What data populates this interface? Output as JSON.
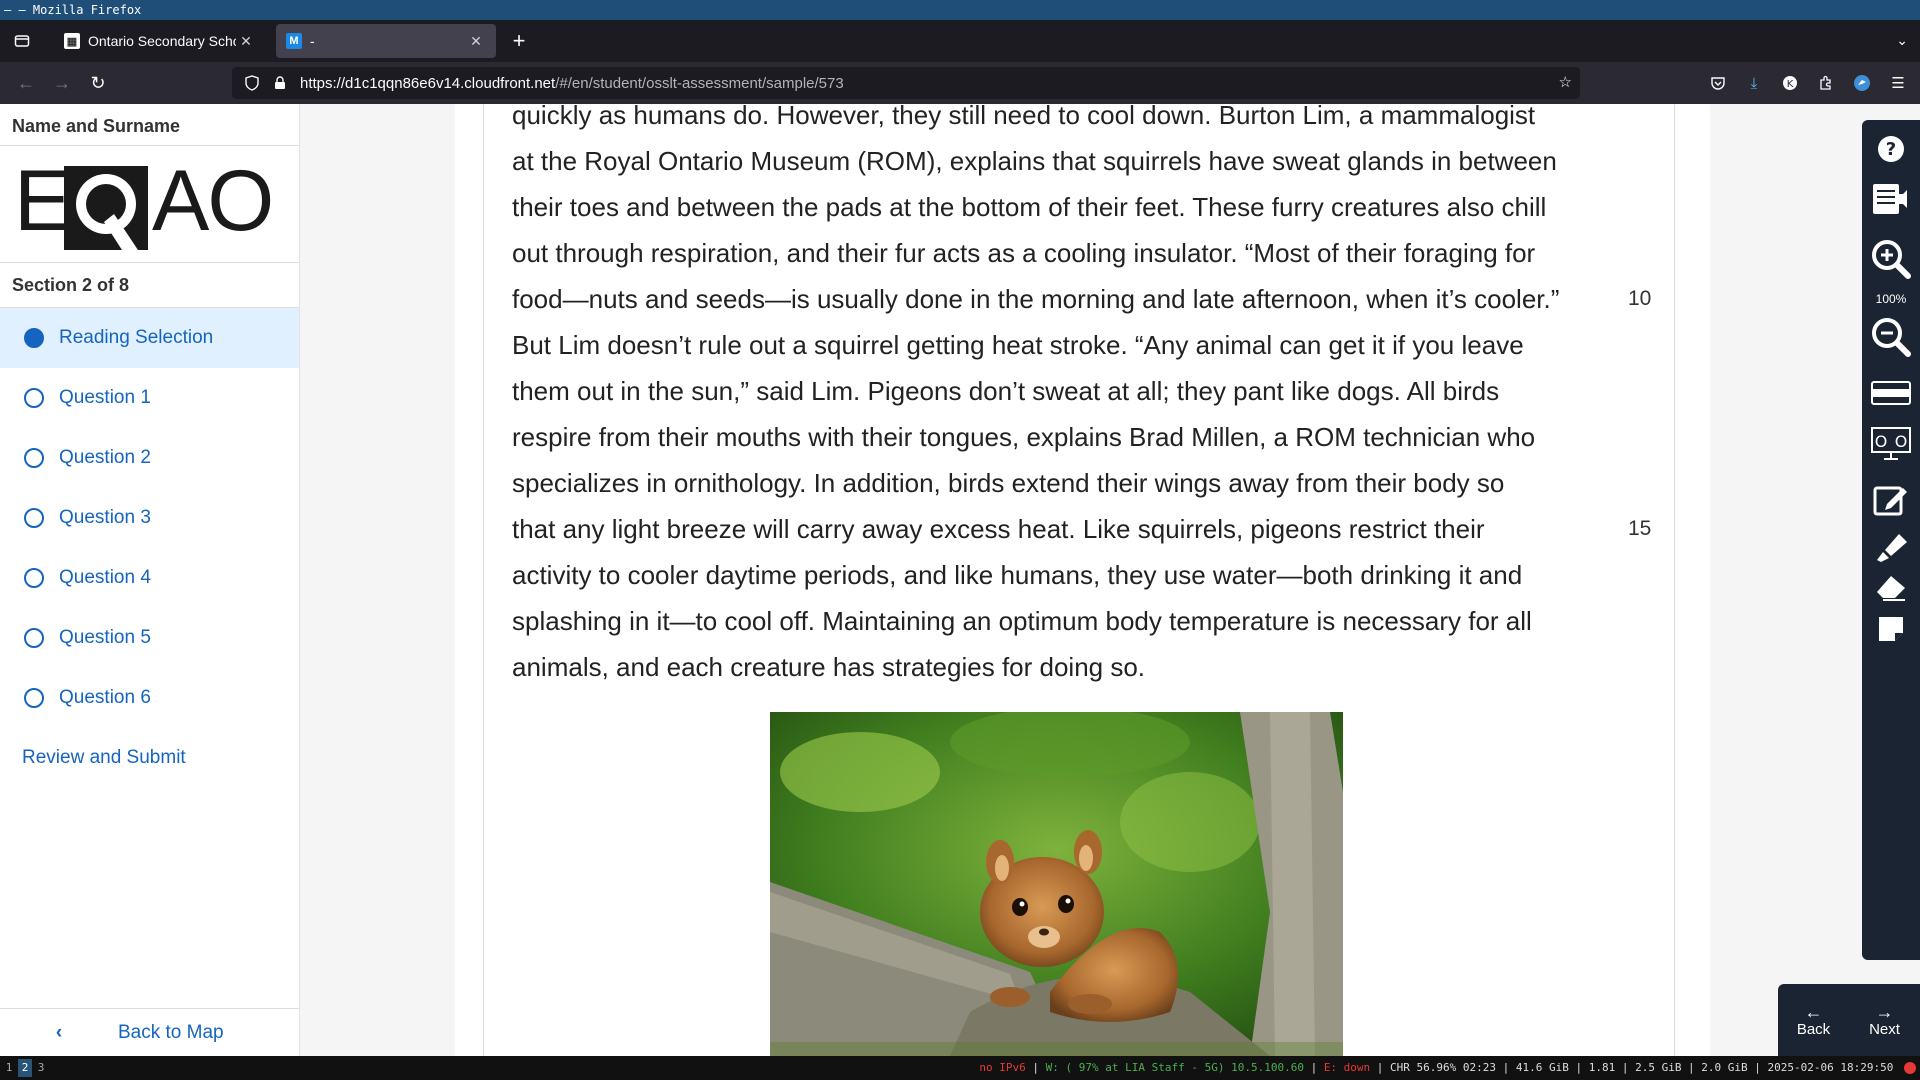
{
  "window": {
    "title": "– — Mozilla Firefox"
  },
  "browser": {
    "tabs": [
      {
        "label": "Ontario Secondary School",
        "favicon_text": "▦",
        "active": false
      },
      {
        "label": "-",
        "favicon_text": "M",
        "active": true
      }
    ],
    "url_host": "https://d1c1qqn86e6v14.cloudfront.net",
    "url_path": "/#/en/student/osslt-assessment/sample/573"
  },
  "sidebar": {
    "name_label": "Name and Surname",
    "logo_text": "EQAO",
    "section": "Section 2 of 8",
    "items": [
      {
        "label": "Reading Selection"
      },
      {
        "label": "Question 1"
      },
      {
        "label": "Question 2"
      },
      {
        "label": "Question 3"
      },
      {
        "label": "Question 4"
      },
      {
        "label": "Question 5"
      },
      {
        "label": "Question 6"
      }
    ],
    "review": "Review and Submit",
    "back": "Back to Map"
  },
  "passage": {
    "lines": [
      {
        "text": "quickly as humans do. However, they still need to cool down. Burton Lim, a mammalogist",
        "num": ""
      },
      {
        "text": "at the Royal Ontario Museum (ROM), explains that squirrels have sweat glands in between",
        "num": ""
      },
      {
        "text": "their toes and between the pads at the bottom of their feet. These furry creatures also chill",
        "num": ""
      },
      {
        "text": "out through respiration, and their fur acts as a cooling insulator. “Most of their foraging for",
        "num": ""
      },
      {
        "text": "food—nuts and seeds—is usually done in the morning and late afternoon, when it’s cooler.”",
        "num": "10"
      },
      {
        "text": "But Lim doesn’t rule out a squirrel getting heat stroke. “Any animal can get it if you leave",
        "num": ""
      },
      {
        "text": "them out in the sun,” said Lim. Pigeons don’t sweat at all; they pant like dogs. All birds",
        "num": ""
      },
      {
        "text": "respire from their mouths with their tongues, explains Brad Millen, a ROM technician who",
        "num": ""
      },
      {
        "text": "specializes in ornithology. In addition, birds extend their wings away from their body so",
        "num": ""
      },
      {
        "text": "that any light breeze will carry away excess heat. Like squirrels, pigeons restrict their",
        "num": "15"
      },
      {
        "text": "activity to cooler daytime periods, and like humans, they use water—both drinking it and",
        "num": ""
      },
      {
        "text": "splashing in it—to cool off. Maintaining an optimum body temperature is necessary for all",
        "num": ""
      },
      {
        "text": "animals, and each creature has strategies for doing so.",
        "num": ""
      }
    ]
  },
  "tools": {
    "zoom": "100%",
    "icons": [
      "help-icon",
      "text-to-speech-icon",
      "zoom-in-icon",
      "zoom-out-icon",
      "line-reader-icon",
      "hide-answer-icon",
      "notepad-icon",
      "highlighter-icon",
      "eraser-icon",
      "sticky-note-icon"
    ]
  },
  "nav": {
    "back": "Back",
    "next": "Next"
  },
  "statusbar": {
    "workspaces": [
      "1",
      "2",
      "3"
    ],
    "active_workspace": "2",
    "ipv6": "no IPv6",
    "wifi": "W: ( 97% at LIA Staff - 5G) 10.5.100.60",
    "eth": "E: down",
    "rest": "CHR 56.96% 02:23 | 41.6 GiB | 1.81 | 2.5 GiB | 2.0 GiB | 2025-02-06 18:29:50"
  }
}
